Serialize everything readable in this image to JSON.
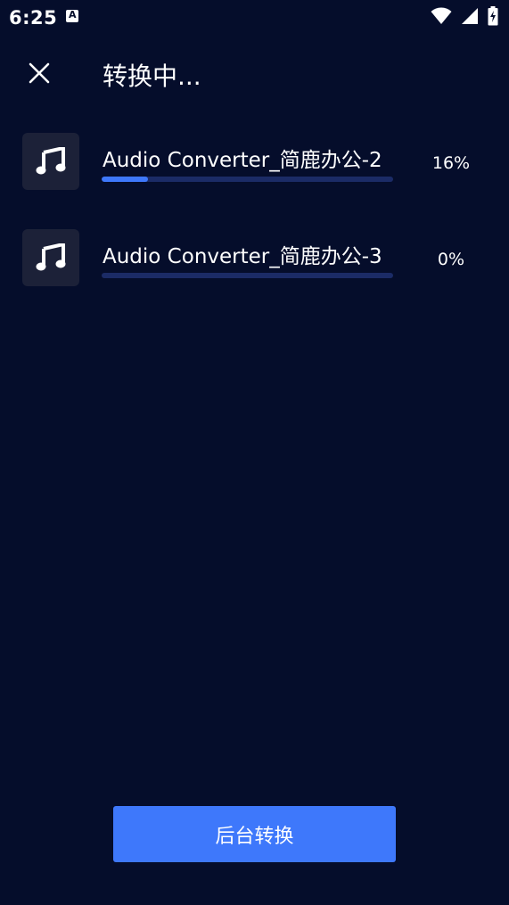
{
  "status_bar": {
    "time": "6:25",
    "notification_glyph": "A",
    "icons": [
      "wifi-icon",
      "signal-icon",
      "battery-charging-icon"
    ]
  },
  "header": {
    "close_icon": "close-icon",
    "title": "转换中..."
  },
  "files": [
    {
      "name": "Audio Converter_简鹿办公-2",
      "percent_label": "16%",
      "progress": 0.16,
      "icon": "music-note-icon"
    },
    {
      "name": "Audio Converter_简鹿办公-3",
      "percent_label": "0%",
      "progress": 0,
      "icon": "music-note-icon"
    }
  ],
  "actions": {
    "background_convert_label": "后台转换"
  },
  "colors": {
    "background": "#050d2b",
    "accent": "#3e78fb",
    "track": "#1b2b66",
    "thumb": "#1c2138"
  }
}
